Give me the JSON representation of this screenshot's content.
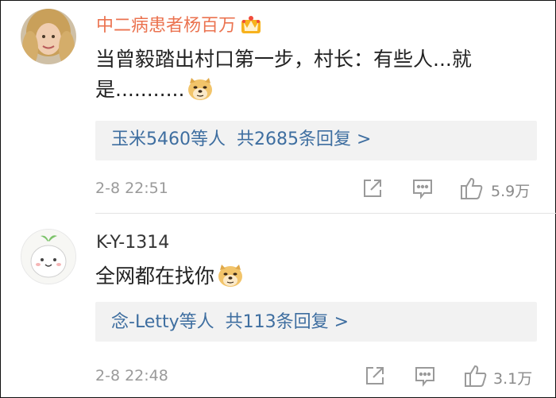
{
  "comments": [
    {
      "username": "中二病患者杨百万",
      "text": "当曾毅踏出村口第一步，村长：有些人...就是...........",
      "replies_from": "玉米5460等人",
      "replies_count": "共2685条回复 >",
      "timestamp": "2-8 22:51",
      "likes": "5.9万",
      "username_color": "#eb7350",
      "badges": [
        "vip-crown-icon"
      ]
    },
    {
      "username": "K-Y-1314",
      "text": "全网都在找你",
      "replies_from": "念-Letty等人",
      "replies_count": "共113条回复 >",
      "timestamp": "2-8 22:48",
      "likes": "3.1万"
    }
  ],
  "colors": {
    "link_blue": "#3e6ea0",
    "meta_gray": "#9a9a9a",
    "reply_box_bg": "#f2f2f2"
  },
  "icons": [
    "share-icon",
    "comment-icon",
    "like-icon",
    "doge-emoji-icon"
  ]
}
